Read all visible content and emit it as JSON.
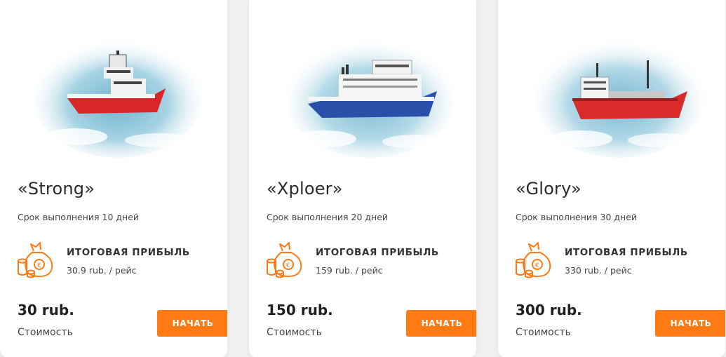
{
  "colors": {
    "accent": "#ff7a12",
    "card_bg": "#ffffff",
    "page_bg": "#f1f1f3"
  },
  "cards": [
    {
      "title": "«Strong»",
      "term": "Срок выполнения 10 дней",
      "profit_label": "ИТОГОВАЯ ПРИБЫЛЬ",
      "profit_value": "30.9 rub. / рейс",
      "price": "30 rub.",
      "price_label": "Стоимость",
      "button_label": "НАЧАТЬ",
      "ship_icon": "supply-vessel-icon",
      "hull_color": "#d8262a"
    },
    {
      "title": "«Xploer»",
      "term": "Срок выполнения 20 дней",
      "profit_label": "ИТОГОВАЯ ПРИБЫЛЬ",
      "profit_value": "159 rub. / рейс",
      "price": "150 rub.",
      "price_label": "Стоимость",
      "button_label": "НАЧАТЬ",
      "ship_icon": "ferry-icon",
      "hull_color": "#2a4fa8"
    },
    {
      "title": "«Glory»",
      "term": "Срок выполнения 30 дней",
      "profit_label": "ИТОГОВАЯ ПРИБЫЛЬ",
      "profit_value": "330 rub. / рейс",
      "price": "300 rub.",
      "price_label": "Стоимость",
      "button_label": "НАЧАТЬ",
      "ship_icon": "tanker-icon",
      "hull_color": "#d92a2c"
    }
  ]
}
